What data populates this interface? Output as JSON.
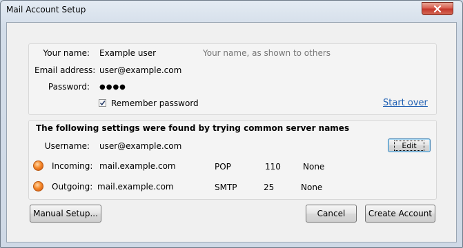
{
  "window": {
    "title": "Mail Account Setup"
  },
  "identity": {
    "name_label": "Your name:",
    "name_value": "Example user",
    "name_hint": "Your name, as shown to others",
    "email_label": "Email address:",
    "email_value": "user@example.com",
    "password_label": "Password:",
    "password_value": "●●●●",
    "remember_label": "Remember password",
    "remember_checked": true,
    "start_over_label": "Start over"
  },
  "settings": {
    "heading": "The following settings were found by trying common server names",
    "username_label": "Username:",
    "username_value": "user@example.com",
    "edit_label": "Edit",
    "incoming": {
      "label": "Incoming:",
      "server": "mail.example.com",
      "protocol": "POP",
      "port": "110",
      "security": "None"
    },
    "outgoing": {
      "label": "Outgoing:",
      "server": "mail.example.com",
      "protocol": "SMTP",
      "port": "25",
      "security": "None"
    },
    "status_color": "#f58a2c"
  },
  "buttons": {
    "manual_setup": "Manual Setup...",
    "cancel": "Cancel",
    "create_account": "Create Account"
  }
}
